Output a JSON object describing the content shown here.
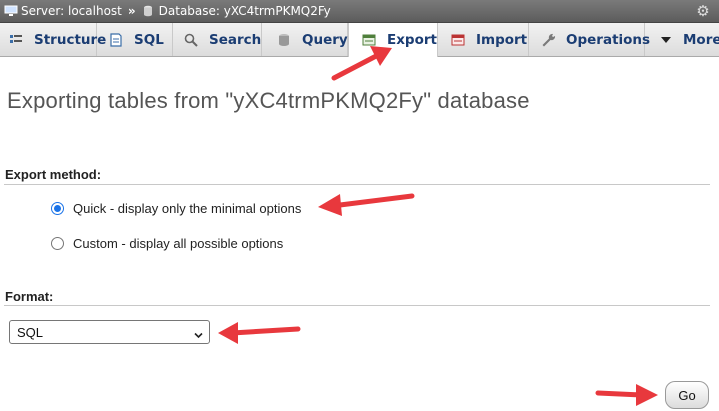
{
  "breadcrumb": {
    "server_label": "Server: localhost",
    "separator": "»",
    "database_label": "Database: yXC4trmPKMQ2Fy"
  },
  "tabs": [
    {
      "label": "Structure",
      "icon": "structure-icon",
      "active": false
    },
    {
      "label": "SQL",
      "icon": "sql-icon",
      "active": false
    },
    {
      "label": "Search",
      "icon": "search-icon",
      "active": false
    },
    {
      "label": "Query",
      "icon": "query-icon",
      "active": false
    },
    {
      "label": "Export",
      "icon": "export-icon",
      "active": true
    },
    {
      "label": "Import",
      "icon": "import-icon",
      "active": false
    },
    {
      "label": "Operations",
      "icon": "wrench-icon",
      "active": false
    },
    {
      "label": "More",
      "icon": "caret-down-icon",
      "active": false
    }
  ],
  "page": {
    "title": "Exporting tables from \"yXC4trmPKMQ2Fy\" database"
  },
  "export_method": {
    "heading": "Export method:",
    "options": [
      {
        "label": "Quick - display only the minimal options",
        "checked": true
      },
      {
        "label": "Custom - display all possible options",
        "checked": false
      }
    ]
  },
  "format": {
    "heading": "Format:",
    "selected": "SQL"
  },
  "go_button": {
    "label": "Go"
  },
  "colors": {
    "annotation_arrow": "#e8383d",
    "tab_text": "#1b3d73",
    "radio_accent": "#1a73e8"
  }
}
